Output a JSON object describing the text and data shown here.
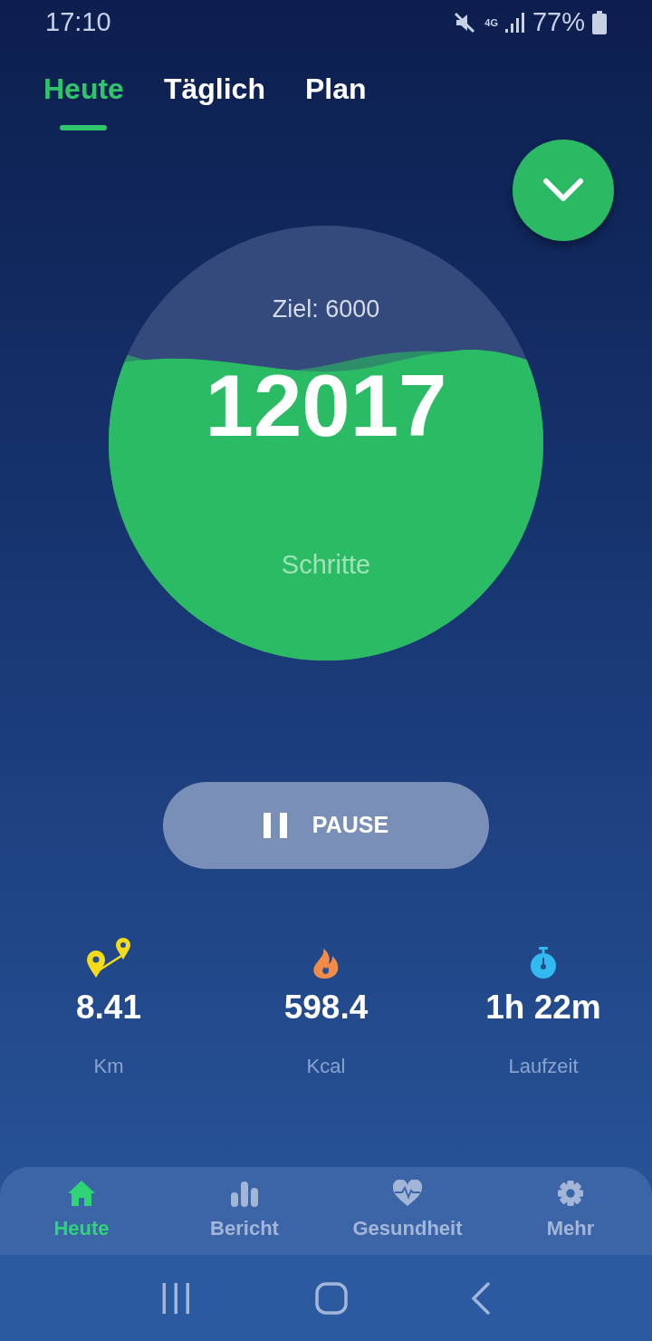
{
  "status_bar": {
    "time": "17:10",
    "network": "4G",
    "battery": "77%"
  },
  "tabs": [
    {
      "label": "Heute",
      "selected": true
    },
    {
      "label": "Täglich",
      "selected": false
    },
    {
      "label": "Plan",
      "selected": false
    }
  ],
  "goal": {
    "label": "Ziel: 6000",
    "steps": "12017",
    "unit": "Schritte"
  },
  "pause_button": {
    "label": "PAUSE"
  },
  "stats": [
    {
      "kind": "distance",
      "value": "8.41",
      "label": "Km"
    },
    {
      "kind": "calories",
      "value": "598.4",
      "label": "Kcal"
    },
    {
      "kind": "duration",
      "value": "1h 22m",
      "label": "Laufzeit"
    }
  ],
  "bottom_nav": [
    {
      "kind": "home",
      "label": "Heute",
      "selected": true
    },
    {
      "kind": "report",
      "label": "Bericht",
      "selected": false
    },
    {
      "kind": "health",
      "label": "Gesundheit",
      "selected": false
    },
    {
      "kind": "more",
      "label": "Mehr",
      "selected": false
    }
  ]
}
